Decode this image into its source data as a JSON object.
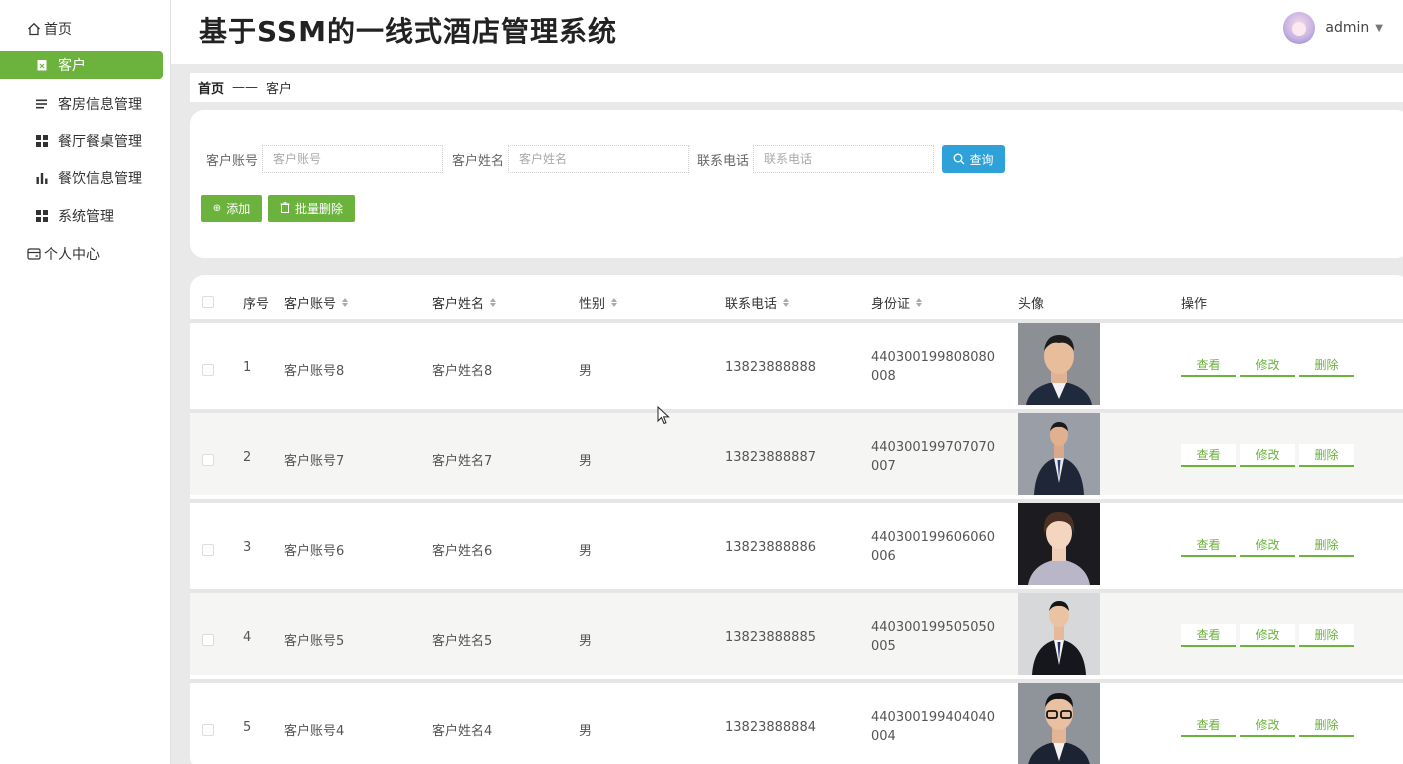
{
  "header": {
    "title": "基于SSM的一线式酒店管理系统",
    "user_name": "admin"
  },
  "sidebar": {
    "items": [
      {
        "label": "首页",
        "icon": "home-icon"
      },
      {
        "label": "客户",
        "icon": "clipboard-icon",
        "active": true
      },
      {
        "label": "客房信息管理",
        "icon": "list-icon"
      },
      {
        "label": "餐厅餐桌管理",
        "icon": "grid-icon"
      },
      {
        "label": "餐饮信息管理",
        "icon": "bar-chart-icon"
      },
      {
        "label": "系统管理",
        "icon": "grid-icon"
      },
      {
        "label": "个人中心",
        "icon": "card-icon"
      }
    ]
  },
  "breadcrumb": {
    "home": "首页",
    "separator": "——",
    "current": "客户"
  },
  "search": {
    "fields": [
      {
        "label": "客户账号",
        "placeholder": "客户账号"
      },
      {
        "label": "客户姓名",
        "placeholder": "客户姓名"
      },
      {
        "label": "联系电话",
        "placeholder": "联系电话"
      }
    ],
    "query_label": "查询",
    "add_label": "添加",
    "batch_delete_label": "批量删除"
  },
  "table": {
    "columns": [
      "序号",
      "客户账号",
      "客户姓名",
      "性别",
      "联系电话",
      "身份证",
      "头像",
      "操作"
    ],
    "actions": {
      "view": "查看",
      "edit": "修改",
      "delete": "删除"
    },
    "rows": [
      {
        "index": "1",
        "account": "客户账号8",
        "name": "客户姓名8",
        "gender": "男",
        "phone": "13823888888",
        "id_card": "440300199808080008"
      },
      {
        "index": "2",
        "account": "客户账号7",
        "name": "客户姓名7",
        "gender": "男",
        "phone": "13823888887",
        "id_card": "440300199707070007"
      },
      {
        "index": "3",
        "account": "客户账号6",
        "name": "客户姓名6",
        "gender": "男",
        "phone": "13823888886",
        "id_card": "440300199606060006"
      },
      {
        "index": "4",
        "account": "客户账号5",
        "name": "客户姓名5",
        "gender": "男",
        "phone": "13823888885",
        "id_card": "440300199505050005"
      },
      {
        "index": "5",
        "account": "客户账号4",
        "name": "客户姓名4",
        "gender": "男",
        "phone": "13823888884",
        "id_card": "440300199404040004"
      }
    ]
  },
  "colors": {
    "accent": "#6cb33e",
    "query": "#2ea1d8"
  }
}
